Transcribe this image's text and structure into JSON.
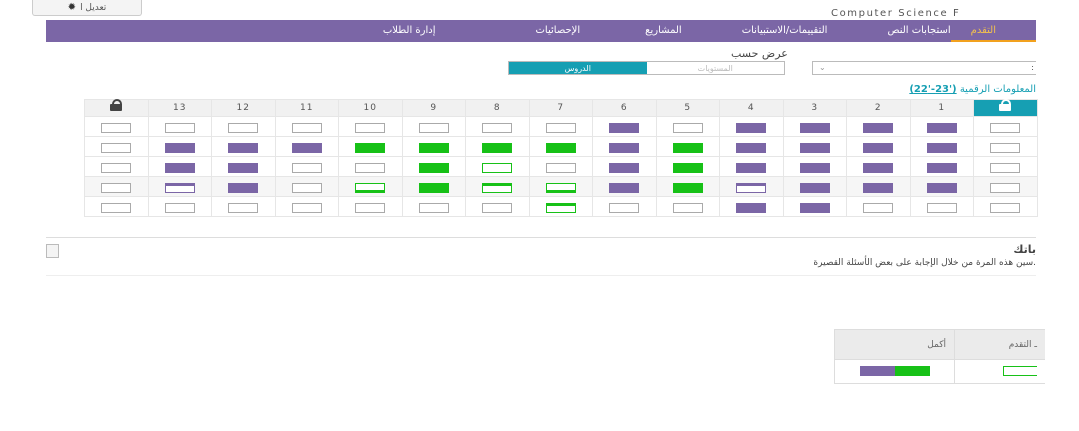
{
  "top_button": {
    "label": "تعديل ا",
    "icon": "gear-icon"
  },
  "course_title": "Computer Science F",
  "nav": [
    {
      "label": "التقدم",
      "active": true,
      "pad_l": 20,
      "pad_r": 40
    },
    {
      "label": "استجابات النص",
      "active": false,
      "pad_l": 60,
      "pad_r": 0
    },
    {
      "label": "التقييمات/الاستبيانات",
      "active": false,
      "pad_l": 60,
      "pad_r": 0
    },
    {
      "label": "المشاريع",
      "active": false,
      "pad_l": 65,
      "pad_r": 0
    },
    {
      "label": "الإحصائيات",
      "active": false,
      "pad_l": 100,
      "pad_r": 0
    },
    {
      "label": "إدارة الطلاب",
      "active": false,
      "pad_l": 0,
      "pad_r": 0
    }
  ],
  "view_by": {
    "label": "عرض حسب",
    "option_levels": "المستويات",
    "option_lessons": "الدروس",
    "selected": "الدروس"
  },
  "user_select": {
    "value": "",
    "right_char": ":"
  },
  "info_link": {
    "text": "المعلومات الرقمية",
    "year": "('23-'22)"
  },
  "progress_table": {
    "columns": [
      "lock",
      "13",
      "12",
      "11",
      "10",
      "9",
      "8",
      "7",
      "6",
      "5",
      "4",
      "3",
      "2",
      "1",
      "lock"
    ],
    "rows": [
      {
        "striped": false,
        "cells": [
          "e",
          "e",
          "e",
          "e",
          "e",
          "e",
          "e",
          "e",
          "p",
          "e",
          "p",
          "p",
          "p",
          "p",
          "e"
        ]
      },
      {
        "striped": false,
        "cells": [
          "e",
          "p",
          "p",
          "p",
          "g",
          "g",
          "g",
          "g",
          "p",
          "g",
          "p",
          "p",
          "p",
          "p",
          "e"
        ]
      },
      {
        "striped": false,
        "cells": [
          "e",
          "p",
          "p",
          "e",
          "e",
          "g",
          "go",
          "e",
          "p",
          "g",
          "p",
          "p",
          "p",
          "p",
          "e"
        ]
      },
      {
        "striped": true,
        "cells": [
          "e",
          "pt",
          "p",
          "e",
          "gb",
          "g",
          "gt",
          "gb",
          "p",
          "g",
          "pt",
          "p",
          "p",
          "p",
          "e"
        ]
      },
      {
        "striped": false,
        "cells": [
          "e",
          "e",
          "e",
          "e",
          "e",
          "e",
          "e",
          "gt",
          "e",
          "e",
          "p",
          "p",
          "e",
          "e",
          "e"
        ]
      }
    ]
  },
  "task": {
    "title": "باتك",
    "description": "سين هذه المرة من خلال الإجابة على بعض الأسئلة القصيرة."
  },
  "legend": {
    "header_col1": "أكمل",
    "header_col2": "ـ التقدم",
    "colors": {
      "purple": "#7b66a6",
      "green": "#17c117",
      "teal": "#169fb3"
    }
  }
}
